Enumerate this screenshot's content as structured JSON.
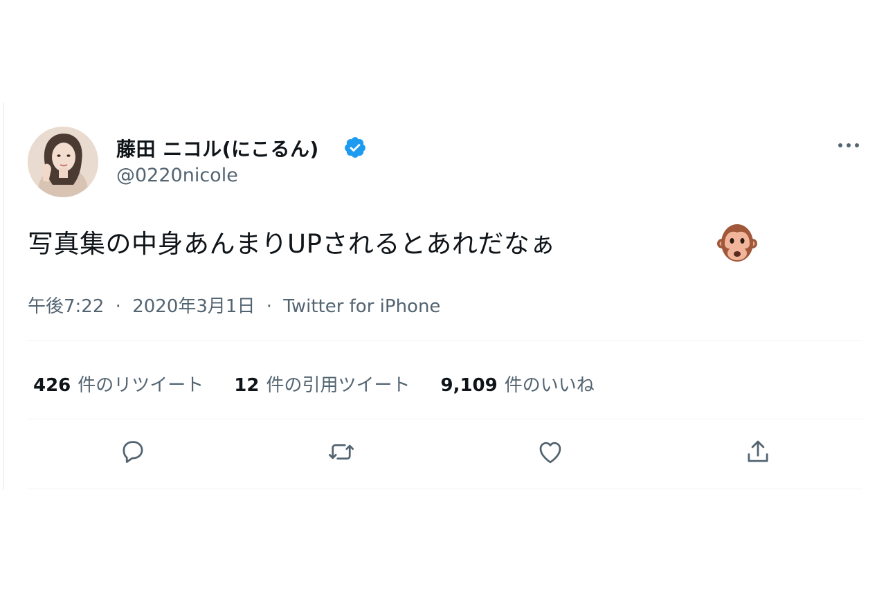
{
  "tweet": {
    "display_name": "藤田 ニコル(にこるん)",
    "handle": "@0220nicole",
    "verified": true,
    "text": "写真集の中身あんまりUPされるとあれだなぁ",
    "emoji": "monkey-face",
    "time": "午後7:22",
    "date": "2020年3月1日",
    "separator": "·",
    "source": "Twitter for iPhone"
  },
  "stats": {
    "retweets": {
      "count": "426",
      "label": "件のリツイート"
    },
    "quotes": {
      "count": "12",
      "label": "件の引用ツイート"
    },
    "likes": {
      "count": "9,109",
      "label": "件のいいね"
    }
  },
  "actions": [
    "reply-icon",
    "retweet-icon",
    "like-icon",
    "share-icon"
  ],
  "colors": {
    "text": "#0f1419",
    "secondary": "#536471",
    "verified": "#1d9bf0",
    "divider": "#eff3f4"
  }
}
